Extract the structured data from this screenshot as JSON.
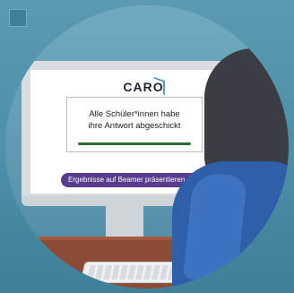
{
  "app": {
    "logo_text": "CARO"
  },
  "message": {
    "text": "Alle Schüler*innen habe\nihre Antwort abgeschickt"
  },
  "button": {
    "label": "Ergebnisse auf Beamer präsentieren"
  },
  "colors": {
    "background": "#4d8fa8",
    "button": "#5a3c8e",
    "progress": "#2b6e36",
    "logo_accent": "#49a6c7"
  }
}
